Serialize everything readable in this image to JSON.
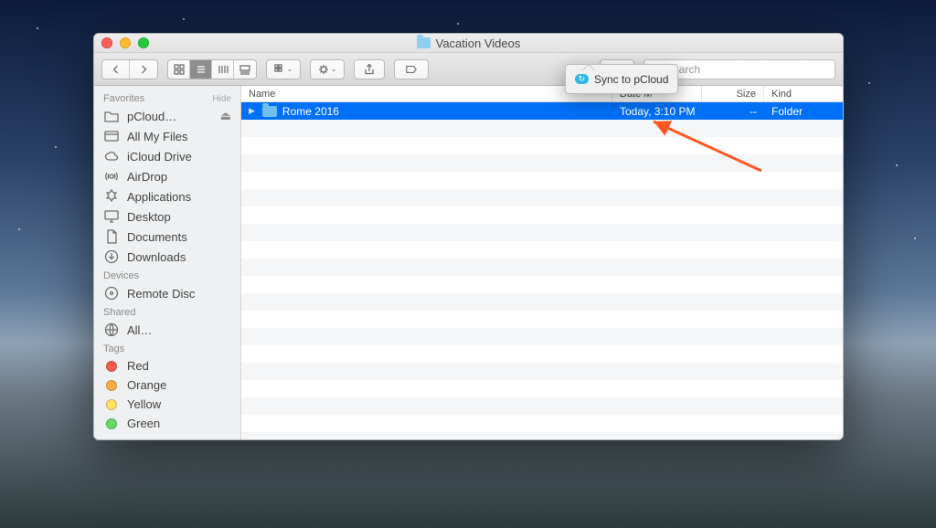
{
  "window": {
    "title": "Vacation Videos"
  },
  "toolbar": {
    "search_placeholder": "Search",
    "popover": {
      "label": "Sync to pCloud"
    }
  },
  "sidebar": {
    "sections": {
      "favorites": {
        "header": "Favorites",
        "hide": "Hide",
        "items": [
          "pCloud…",
          "All My Files",
          "iCloud Drive",
          "AirDrop",
          "Applications",
          "Desktop",
          "Documents",
          "Downloads"
        ]
      },
      "devices": {
        "header": "Devices",
        "items": [
          "Remote Disc"
        ]
      },
      "shared": {
        "header": "Shared",
        "items": [
          "All…"
        ]
      },
      "tags": {
        "header": "Tags",
        "items": [
          "Red",
          "Orange",
          "Yellow",
          "Green"
        ]
      }
    }
  },
  "columns": {
    "name": "Name",
    "date": "Date Modified",
    "date_clipped": "Date M",
    "size": "Size",
    "kind": "Kind"
  },
  "rows": [
    {
      "name": "Rome 2016",
      "date": "Today, 3:10 PM",
      "size": "--",
      "kind": "Folder",
      "selected": true
    }
  ]
}
